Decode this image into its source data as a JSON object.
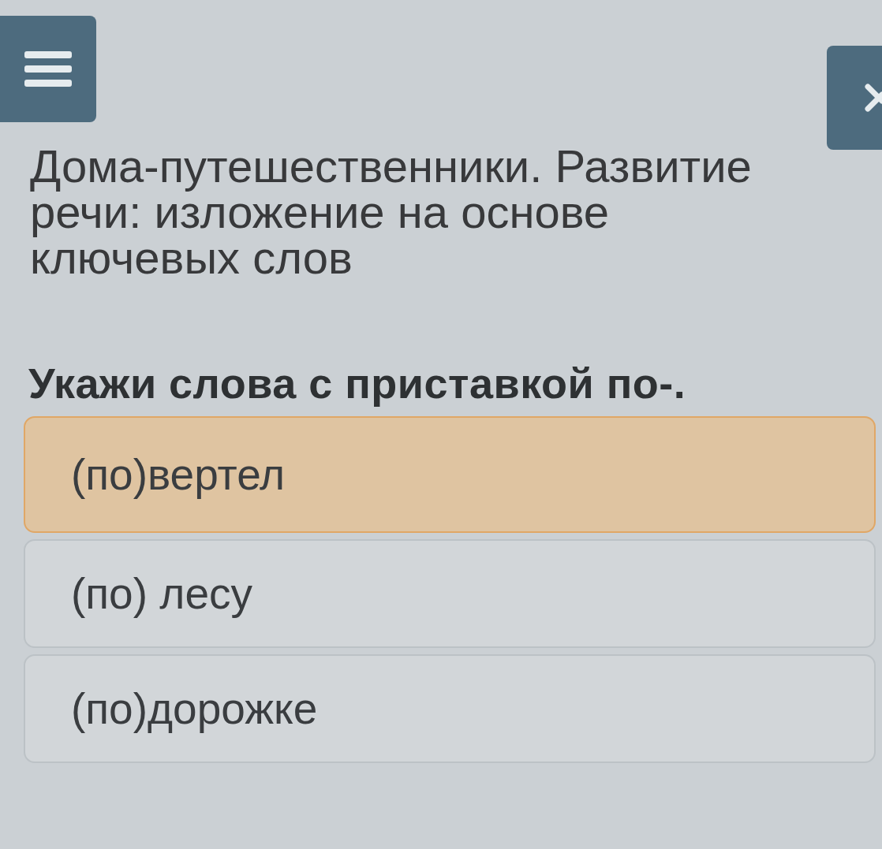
{
  "lesson_title": "Дома-путешественники. Развитие речи: изложение на основе ключевых слов",
  "question": "Укажи слова с приставкой по-.",
  "options": [
    {
      "label": "(по)вертел",
      "selected": true
    },
    {
      "label": "(по) лесу",
      "selected": false
    },
    {
      "label": "(по)дорожке",
      "selected": false
    }
  ]
}
